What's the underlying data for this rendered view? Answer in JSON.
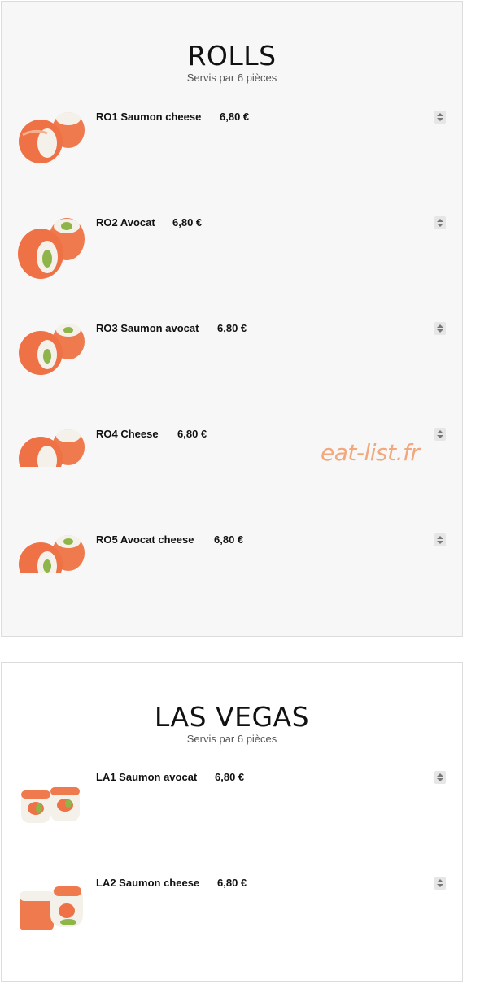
{
  "watermark": "eat-list.fr",
  "sections": [
    {
      "title": "ROLLS",
      "subtitle": "Servis par 6 pièces",
      "items": [
        {
          "name": "RO1 Saumon cheese",
          "price": "6,80 €"
        },
        {
          "name": "RO2 Avocat",
          "price": "6,80 €"
        },
        {
          "name": "RO3 Saumon avocat",
          "price": "6,80 €"
        },
        {
          "name": "RO4 Cheese",
          "price": "6,80 €"
        },
        {
          "name": "RO5 Avocat cheese",
          "price": "6,80 €"
        }
      ]
    },
    {
      "title": "LAS VEGAS",
      "subtitle": "Servis par 6 pièces",
      "items": [
        {
          "name": "LA1 Saumon avocat",
          "price": "6,80 €"
        },
        {
          "name": "LA2 Saumon cheese",
          "price": "6,80 €"
        }
      ]
    }
  ],
  "colors": {
    "salmon": "#ef7a4e",
    "rice": "#f4f1ea",
    "avocado": "#8fb44a",
    "watermark": "#f3a77d"
  },
  "icons": {
    "thumbnail": "sushi-roll-photo",
    "stepper": "up-down-stepper-icon"
  }
}
